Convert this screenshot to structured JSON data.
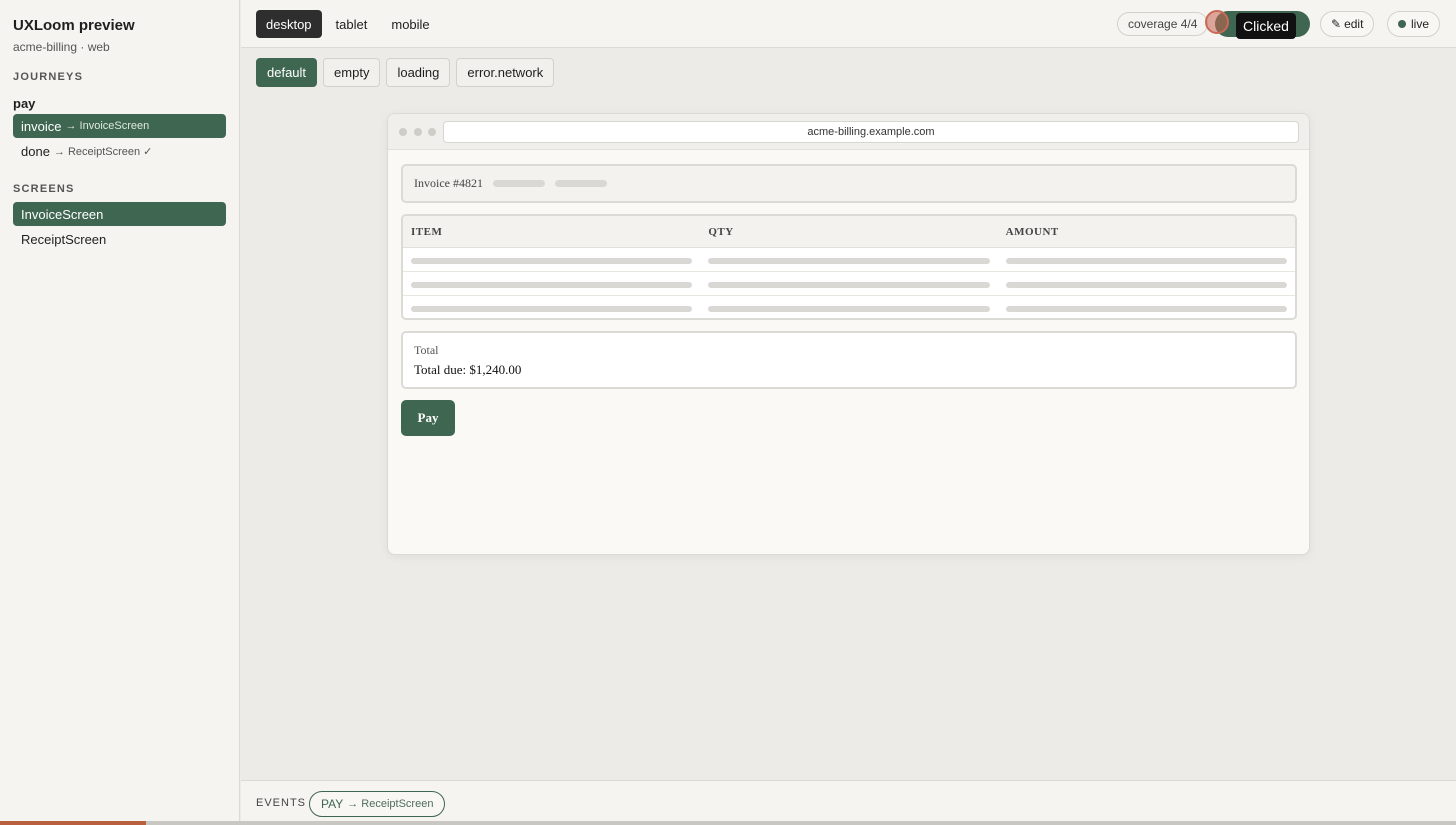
{
  "app": {
    "title": "UXLoom preview",
    "subtitle": "acme-billing · web"
  },
  "sidebar": {
    "journeys_heading": "JOURNEYS",
    "journey_name": "pay",
    "journey_steps": [
      {
        "label": "invoice",
        "target": "→ InvoiceScreen"
      },
      {
        "label": "done",
        "target": "→ ReceiptScreen ✓"
      }
    ],
    "screens_heading": "SCREENS",
    "screens": [
      "InvoiceScreen",
      "ReceiptScreen"
    ]
  },
  "device_tabs": [
    "desktop",
    "tablet",
    "mobile"
  ],
  "toolbar": {
    "coverage": "coverage 4/4",
    "tooltip": "Clicked",
    "edit_icon": "✎",
    "edit_label": "edit",
    "live_label": "live"
  },
  "state_tabs": [
    "default",
    "empty",
    "loading",
    "error.network"
  ],
  "browser": {
    "url": "acme-billing.example.com"
  },
  "invoice": {
    "title": "Invoice #4821",
    "columns": [
      "ITEM",
      "QTY",
      "AMOUNT"
    ],
    "total_label": "Total",
    "total_value": "Total due: $1,240.00",
    "pay_label": "Pay"
  },
  "events": {
    "label": "EVENTS",
    "event_name": "PAY",
    "event_target": "→ ReceiptScreen"
  },
  "progress": {
    "fraction": 0.1
  },
  "colors": {
    "accent": "#3f6650",
    "progress": "#b9613f",
    "click_marker": "#c96a56"
  }
}
